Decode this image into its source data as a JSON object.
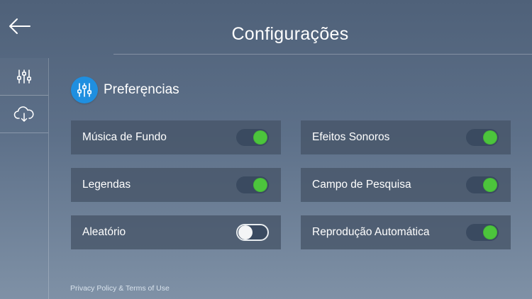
{
  "header": {
    "title": "Configurações"
  },
  "sidebar": {
    "items": [
      {
        "icon": "sliders-icon",
        "active": true
      },
      {
        "icon": "cloud-download-icon",
        "active": false
      }
    ]
  },
  "section": {
    "title": "Preferęncias",
    "icon": "sliders-icon",
    "accent_color": "#1f8fe0"
  },
  "settings": [
    {
      "label": "Música de Fundo",
      "enabled": true
    },
    {
      "label": "Efeitos Sonoros",
      "enabled": true
    },
    {
      "label": "Legendas",
      "enabled": true
    },
    {
      "label": "Campo de Pesquisa",
      "enabled": true
    },
    {
      "label": "Aleatório",
      "enabled": false
    },
    {
      "label": "Reprodução Automática",
      "enabled": true
    }
  ],
  "toggle_on_color": "#4cc53c",
  "footer": {
    "link_text": "Privacy Policy & Terms of Use"
  }
}
